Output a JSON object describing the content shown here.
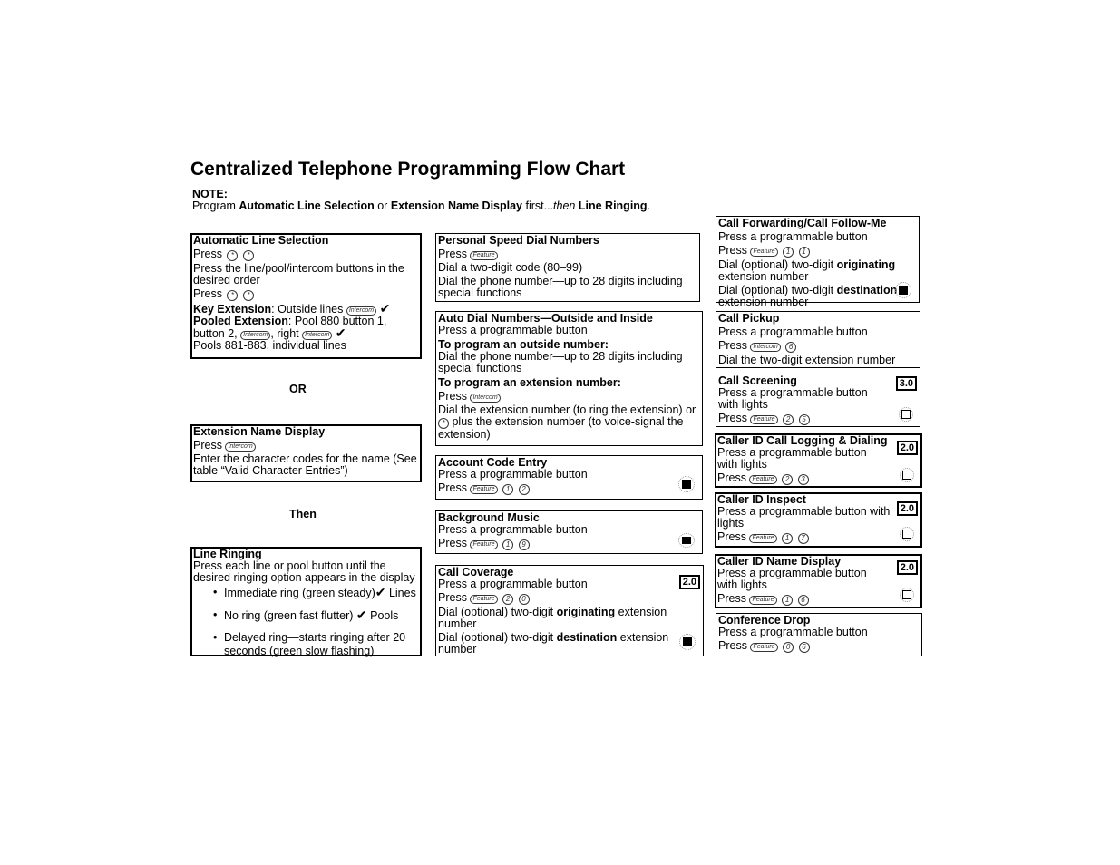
{
  "title": "Centralized Telephone Programming Flow Chart",
  "note": {
    "label": "NOTE:",
    "prefix": "Program ",
    "item1": "Automatic Line Selection",
    "or": " or ",
    "item2": "Extension Name Display",
    "first": " first...",
    "then": "then",
    "space": " ",
    "item3": "Line Ringing",
    "end": "."
  },
  "connectors": {
    "or": "OR",
    "then": "Then"
  },
  "keys": {
    "feature": "Feature",
    "intercom": "Intercom",
    "star": "*"
  },
  "check": "✔",
  "left": {
    "als": {
      "title": "Automatic Line Selection",
      "press": "Press",
      "line2": "Press the line/pool/intercom buttons in the desired order",
      "press2": "Press",
      "key_ext_label": "Key Extension",
      "key_ext_text": ": Outside lines",
      "pooled_label": "Pooled Extension",
      "pooled_text": ": Pool 880 button 1,",
      "pooled_text2a": "button 2,",
      "pooled_text2b": ", right",
      "pools": "Pools 881-883, individual lines"
    },
    "end": {
      "title": "Extension Name Display",
      "press": "Press",
      "line2": "Enter the character codes for the name (See table “Valid Character Entries”)"
    },
    "lr": {
      "title": "Line Ringing",
      "line1": "Press each line or pool button until the desired ringing option appears in the display",
      "opt1": "Immediate ring (green steady)",
      "opt1_after": " Lines",
      "opt2": "No ring (green fast flutter) ",
      "opt2_after": " Pools",
      "opt3": "Delayed ring—starts ringing after 20 seconds (green slow flashing)"
    }
  },
  "middle": {
    "psd": {
      "title": "Personal Speed Dial Numbers",
      "press": "Press",
      "line2": "Dial a two-digit code (80–99)",
      "line3": "Dial the phone number—up to 28 digits including special functions"
    },
    "adn": {
      "title": "Auto Dial Numbers—Outside and Inside",
      "line1": "Press a programmable button",
      "sub1": "To program an outside number:",
      "line2": "Dial the phone number—up to 28 digits including special functions",
      "sub2": "To program an extension number:",
      "press": "Press",
      "line3a": "Dial the extension number (to ring the extension) or",
      "line3b": " plus the extension number (to voice-signal the extension)"
    },
    "ace": {
      "title": "Account Code Entry",
      "line1": "Press a programmable button",
      "press": "Press",
      "digits": [
        "1",
        "2"
      ]
    },
    "bgm": {
      "title": "Background Music",
      "line1": "Press a programmable button",
      "press": "Press",
      "digits": [
        "1",
        "9"
      ]
    },
    "cc": {
      "title": "Call Coverage",
      "badge": "2.0",
      "line1": "Press a programmable button",
      "press": "Press",
      "digits": [
        "2",
        "0"
      ],
      "orig_pre": "Dial (optional) two-digit ",
      "orig_bold": "originating",
      "orig_post": " extension number",
      "dest_pre": "Dial (optional) two-digit ",
      "dest_bold": "destination",
      "dest_post": " extension number"
    }
  },
  "right": {
    "cf": {
      "title": "Call Forwarding/Call Follow-Me",
      "line1": "Press a programmable button",
      "press": "Press",
      "digits": [
        "1",
        "1"
      ],
      "orig_pre": "Dial (optional) two-digit ",
      "orig_bold": "originating",
      "orig_post": " extension number",
      "dest_pre": "Dial (optional) two-digit ",
      "dest_bold": "destination",
      "dest_post": " extension number"
    },
    "cp": {
      "title": "Call Pickup",
      "line1": "Press a programmable button",
      "press": "Press",
      "digits": [
        "6"
      ],
      "line3": "Dial the two-digit extension number"
    },
    "cs": {
      "title": "Call Screening",
      "badge": "3.0",
      "line1": "Press a programmable button with lights",
      "press": "Press",
      "digits": [
        "2",
        "5"
      ]
    },
    "cidl": {
      "title": "Caller ID Call Logging & Dialing",
      "badge": "2.0",
      "line1": "Press a programmable button with lights",
      "press": "Press",
      "digits": [
        "2",
        "3"
      ]
    },
    "cidi": {
      "title": "Caller ID Inspect",
      "badge": "2.0",
      "line1": "Press a programmable button with lights",
      "press": "Press",
      "digits": [
        "1",
        "7"
      ]
    },
    "cidn": {
      "title": "Caller ID Name Display",
      "badge": "2.0",
      "line1": "Press a programmable button with lights",
      "press": "Press",
      "digits": [
        "1",
        "6"
      ]
    },
    "cd": {
      "title": "Conference Drop",
      "line1": "Press a programmable button",
      "press": "Press",
      "digits": [
        "0",
        "6"
      ]
    }
  }
}
